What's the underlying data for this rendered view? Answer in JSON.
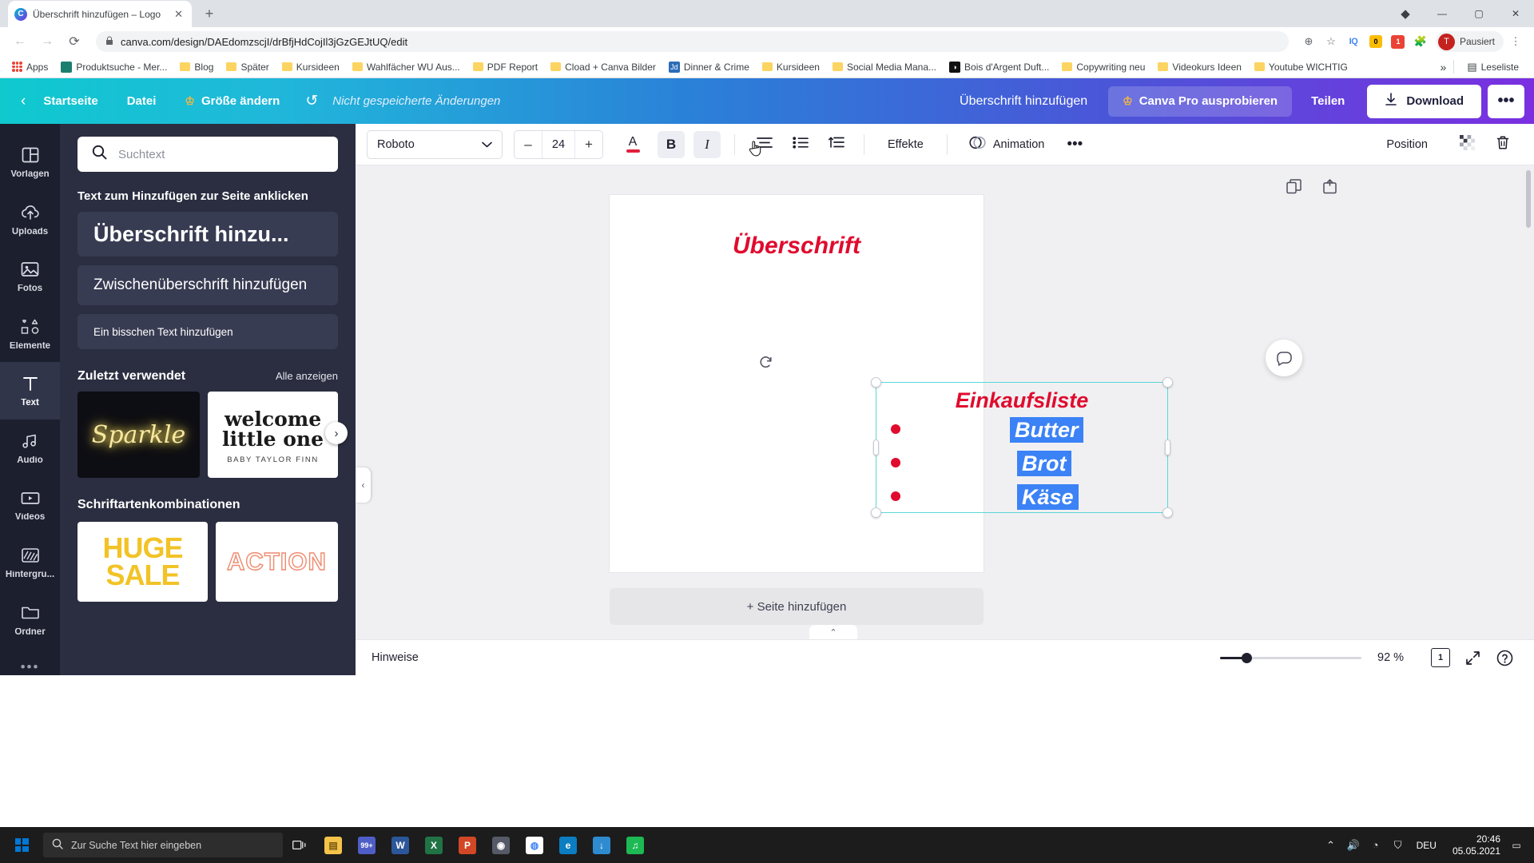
{
  "browser": {
    "tab": {
      "title": "Überschrift hinzufügen – Logo",
      "favicon": "C",
      "close": "✕"
    },
    "newtab": "+",
    "window_controls": {
      "extensions": "◆",
      "minimize": "—",
      "maximize": "▢",
      "close": "✕"
    },
    "nav": {
      "back": "←",
      "forward": "→",
      "reload": "⟳"
    },
    "omnibox": {
      "lock": "🔒",
      "url": "canva.com/design/DAEdomzscjI/drBfjHdCojIl3jGzGEJtUQ/edit"
    },
    "omni_right": {
      "zoom": "⊕",
      "iq": "IQ",
      "yellow": "0",
      "red": "1",
      "ext": "⋯"
    },
    "profile": {
      "avatar": "T",
      "label": "Pausiert"
    },
    "bookmarks": [
      {
        "label": "Apps",
        "icon": "apps-grid-icon"
      },
      {
        "label": "Produktsuche - Mer...",
        "icon": "teal-thumb-icon"
      },
      {
        "label": "Blog",
        "icon": "folder-icon"
      },
      {
        "label": "Später",
        "icon": "folder-icon"
      },
      {
        "label": "Kursideen",
        "icon": "folder-icon"
      },
      {
        "label": "Wahlfächer WU Aus...",
        "icon": "folder-icon"
      },
      {
        "label": "PDF Report",
        "icon": "folder-icon"
      },
      {
        "label": "Cload + Canva Bilder",
        "icon": "folder-icon"
      },
      {
        "label": "Dinner & Crime",
        "icon": "blue-thumb-icon",
        "glyph": "Jd"
      },
      {
        "label": "Kursideen",
        "icon": "folder-icon"
      },
      {
        "label": "Social Media Mana...",
        "icon": "folder-icon"
      },
      {
        "label": "Bois d'Argent Duft...",
        "icon": "black-thumb-icon",
        "glyph": "◑"
      },
      {
        "label": "Copywriting neu",
        "icon": "folder-icon"
      },
      {
        "label": "Videokurs Ideen",
        "icon": "folder-icon"
      },
      {
        "label": "Youtube WICHTIG",
        "icon": "folder-icon"
      }
    ],
    "bookmarks_overflow": "»",
    "reading_list": {
      "label": "Leseliste",
      "icon": "reading-list-icon"
    }
  },
  "canva_header": {
    "back": "‹",
    "home": "Startseite",
    "file": "Datei",
    "resize": "Größe ändern",
    "undo": "↺",
    "unsaved": "Nicht gespeicherte Änderungen",
    "design_title": "Überschrift hinzufügen",
    "pro": "Canva Pro ausprobieren",
    "share": "Teilen",
    "download": "Download",
    "more": "•••",
    "crown": "♔"
  },
  "rail": {
    "items": [
      {
        "label": "Vorlagen",
        "icon": "templates-icon",
        "active": false
      },
      {
        "label": "Uploads",
        "icon": "upload-cloud-icon",
        "active": false
      },
      {
        "label": "Fotos",
        "icon": "photo-icon",
        "active": false
      },
      {
        "label": "Elemente",
        "icon": "shapes-icon",
        "active": false
      },
      {
        "label": "Text",
        "icon": "text-T-icon",
        "active": true
      },
      {
        "label": "Audio",
        "icon": "music-note-icon",
        "active": false
      },
      {
        "label": "Videos",
        "icon": "video-icon",
        "active": false
      },
      {
        "label": "Hintergru...",
        "icon": "background-icon",
        "active": false
      },
      {
        "label": "Ordner",
        "icon": "folder-icon",
        "active": false
      }
    ],
    "more": "•••"
  },
  "panel": {
    "search_placeholder": "Suchtext",
    "search_icon": "search-icon",
    "heading": "Text zum Hinzufügen zur Seite anklicken",
    "options": [
      {
        "label": "Überschrift hinzu...",
        "size": "h1"
      },
      {
        "label": "Zwischenüberschrift hinzufügen",
        "size": "h2"
      },
      {
        "label": "Ein bisschen Text hinzufügen",
        "size": "h3"
      }
    ],
    "recent_title": "Zuletzt verwendet",
    "recent_link": "Alle anzeigen",
    "recent_cards": [
      {
        "text": "Sparkle",
        "style": "neon"
      },
      {
        "text1": "welcome",
        "text2": "little one",
        "text3": "BABY TAYLOR FINN",
        "style": "welcome"
      }
    ],
    "combos_title": "Schriftartenkombinationen",
    "combo_cards": [
      {
        "line1": "HUGE",
        "line2": "SALE"
      },
      {
        "line1": "ACTION"
      }
    ],
    "collapse_icon": "‹"
  },
  "toolbar": {
    "font": "Roboto",
    "font_chevron": "⌄",
    "decrease": "–",
    "size": "24",
    "increase": "+",
    "text_color_icon": "A",
    "text_color": "#e0203c",
    "bold": "B",
    "italic": "I",
    "align_icon": "align-icon",
    "list_icon": "bullet-list-icon",
    "spacing_icon": "line-spacing-icon",
    "effects": "Effekte",
    "animation": "Animation",
    "more": "•••",
    "position": "Position",
    "transparency_icon": "transparency-icon",
    "delete_icon": "trash-icon"
  },
  "canvas": {
    "tools": {
      "duplicate": "duplicate-icon",
      "add": "add-page-icon"
    },
    "page_title": "Überschrift",
    "list_title": "Einkaufsliste",
    "list_items": [
      "Butter",
      "Brot",
      "Käse"
    ],
    "rotate_icon": "rotate-icon",
    "comment_icon": "comment-icon",
    "add_page": "+ Seite hinzufügen",
    "collapse_icon": "⌃"
  },
  "statusbar": {
    "notes": "Hinweise",
    "zoom": "92 %",
    "page_number": "1",
    "fullscreen_icon": "expand-icon",
    "help_icon": "help-icon"
  },
  "taskbar": {
    "search_placeholder": "Zur Suche Text hier eingeben",
    "search_icon": "search-icon",
    "taskview_icon": "task-view-icon",
    "apps": [
      {
        "name": "file-explorer",
        "glyph": "🗂",
        "color": "#f5c24a"
      },
      {
        "name": "teams",
        "glyph": "99+",
        "color": "#4f5ec7"
      },
      {
        "name": "word",
        "glyph": "W",
        "color": "#2b579a"
      },
      {
        "name": "excel",
        "glyph": "X",
        "color": "#217346"
      },
      {
        "name": "powerpoint",
        "glyph": "P",
        "color": "#d24726"
      },
      {
        "name": "disc",
        "glyph": "◉",
        "color": "#555a66"
      },
      {
        "name": "chrome",
        "glyph": "◍",
        "color": "#4285f4"
      },
      {
        "name": "edge",
        "glyph": "e",
        "color": "#0b7dc1"
      },
      {
        "name": "download-mgr",
        "glyph": "↓",
        "color": "#2e8bd0"
      },
      {
        "name": "spotify",
        "glyph": "♫",
        "color": "#1db954"
      }
    ],
    "tray": {
      "up": "⌃",
      "sound": "🔊",
      "network": "◔",
      "shield": "⛉"
    },
    "language": "DEU",
    "time": "20:46",
    "date": "05.05.2021",
    "notification": "▭"
  }
}
